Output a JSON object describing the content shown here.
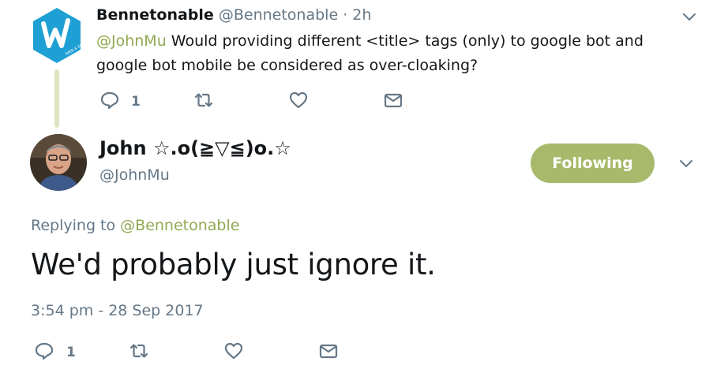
{
  "parent_tweet": {
    "author_name": "Bennetonable",
    "author_handle": "@Bennetonable",
    "separator": "·",
    "age": "2h",
    "mention": "@JohnMu",
    "text": " Would providing different <title> tags (only) to google bot and google bot mobile be considered as over-cloaking?",
    "logo_text": "WEB & SEO",
    "reply_count": "1",
    "icons": [
      "reply-icon",
      "retweet-icon",
      "like-icon",
      "message-icon",
      "chevron-down-icon"
    ],
    "colors": {
      "logo": "#1ea0d4",
      "thread_line": "#dbe6c0",
      "mention": "#91a851"
    }
  },
  "main_tweet": {
    "author_name": "John ☆.o(≧▽≦)o.☆",
    "author_handle": "@JohnMu",
    "follow_label": "Following",
    "replying_prefix": "Replying to ",
    "replying_to": "@Bennetonable",
    "text": "We'd probably just ignore it.",
    "timestamp": "3:54 pm - 28 Sep 2017",
    "reply_count": "1",
    "colors": {
      "follow_button": "#a8b96b",
      "muted_text": "#657786"
    }
  }
}
